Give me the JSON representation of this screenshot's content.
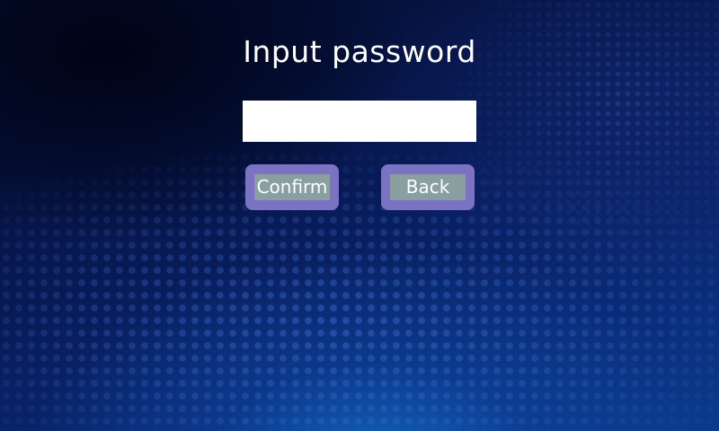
{
  "screen": {
    "title": "Input password"
  },
  "password_field": {
    "value": "",
    "placeholder": ""
  },
  "buttons": {
    "confirm_label": "Confirm",
    "back_label": "Back"
  },
  "colors": {
    "button_outer": "#7b72c4",
    "button_inner": "#8aa0a0",
    "input_background": "#ffffff",
    "title_text": "#ffffff"
  }
}
